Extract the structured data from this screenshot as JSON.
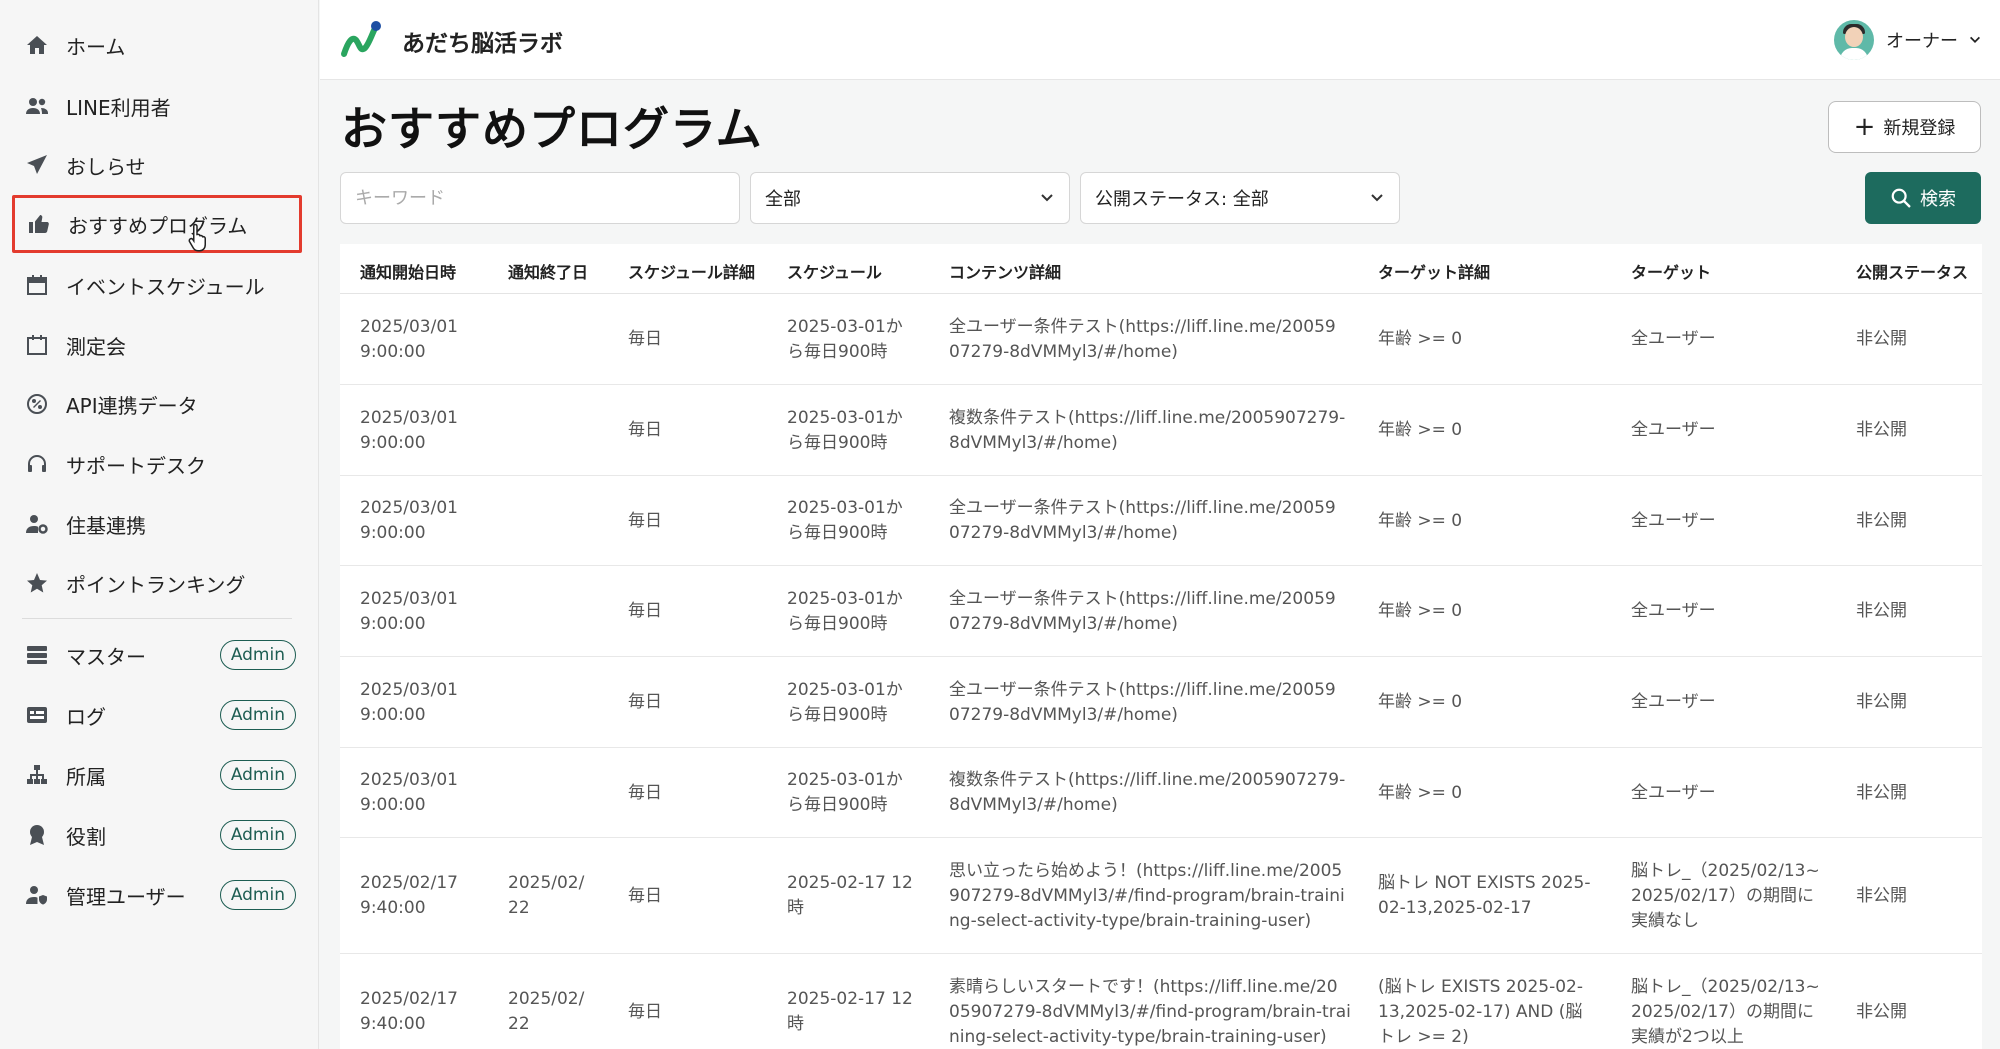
{
  "header": {
    "app_title": "あだち脳活ラボ",
    "user_name": "オーナー"
  },
  "sidebar": {
    "items": [
      {
        "label": "ホーム",
        "icon": "home-icon"
      },
      {
        "label": "LINE利用者",
        "icon": "users-icon"
      },
      {
        "label": "おしらせ",
        "icon": "send-icon"
      },
      {
        "label": "おすすめプログラム",
        "icon": "thumbs-up-icon"
      },
      {
        "label": "イベントスケジュール",
        "icon": "calendar-icon"
      },
      {
        "label": "測定会",
        "icon": "calendar-blank-icon"
      },
      {
        "label": "API連携データ",
        "icon": "link-icon"
      },
      {
        "label": "サポートデスク",
        "icon": "headset-icon"
      },
      {
        "label": "住基連携",
        "icon": "user-gear-icon"
      },
      {
        "label": "ポイントランキング",
        "icon": "star-icon"
      }
    ],
    "admin_items": [
      {
        "label": "マスター",
        "badge": "Admin",
        "icon": "database-icon"
      },
      {
        "label": "ログ",
        "badge": "Admin",
        "icon": "log-icon"
      },
      {
        "label": "所属",
        "badge": "Admin",
        "icon": "org-icon"
      },
      {
        "label": "役割",
        "badge": "Admin",
        "icon": "award-icon"
      },
      {
        "label": "管理ユーザー",
        "badge": "Admin",
        "icon": "user-shield-icon"
      }
    ]
  },
  "main": {
    "title": "おすすめプログラム",
    "new_button": "新規登録",
    "search": {
      "keyword_placeholder": "キーワード",
      "category_value": "全部",
      "status_value": "公開ステータス: 全部",
      "button": "検索"
    },
    "table": {
      "columns": [
        "通知開始日時",
        "通知終了日",
        "スケジュール詳細",
        "スケジュール",
        "コンテンツ詳細",
        "ターゲット詳細",
        "ターゲット",
        "公開ステータス"
      ],
      "rows": [
        {
          "start_1": "2025/03/01",
          "start_2": "9:00:00",
          "end_1": "",
          "end_2": "",
          "detail": "毎日",
          "sched_1": "2025-03-01か",
          "sched_2": "ら毎日900時",
          "content_1": "全ユーザー条件テスト(https://liff.line.me/20059",
          "content_2": "07279-8dVMMyl3/#/home)",
          "content_3": "",
          "tdetail_1": "年齢 >= 0",
          "tdetail_2": "",
          "tdetail_3": "",
          "target_1": "全ユーザー",
          "target_2": "",
          "target_3": "",
          "status": "非公開"
        },
        {
          "start_1": "2025/03/01",
          "start_2": "9:00:00",
          "end_1": "",
          "end_2": "",
          "detail": "毎日",
          "sched_1": "2025-03-01か",
          "sched_2": "ら毎日900時",
          "content_1": "複数条件テスト(https://liff.line.me/2005907279-",
          "content_2": "8dVMMyl3/#/home)",
          "content_3": "",
          "tdetail_1": "年齢 >= 0",
          "tdetail_2": "",
          "tdetail_3": "",
          "target_1": "全ユーザー",
          "target_2": "",
          "target_3": "",
          "status": "非公開"
        },
        {
          "start_1": "2025/03/01",
          "start_2": "9:00:00",
          "end_1": "",
          "end_2": "",
          "detail": "毎日",
          "sched_1": "2025-03-01か",
          "sched_2": "ら毎日900時",
          "content_1": "全ユーザー条件テスト(https://liff.line.me/20059",
          "content_2": "07279-8dVMMyl3/#/home)",
          "content_3": "",
          "tdetail_1": "年齢 >= 0",
          "tdetail_2": "",
          "tdetail_3": "",
          "target_1": "全ユーザー",
          "target_2": "",
          "target_3": "",
          "status": "非公開"
        },
        {
          "start_1": "2025/03/01",
          "start_2": "9:00:00",
          "end_1": "",
          "end_2": "",
          "detail": "毎日",
          "sched_1": "2025-03-01か",
          "sched_2": "ら毎日900時",
          "content_1": "全ユーザー条件テスト(https://liff.line.me/20059",
          "content_2": "07279-8dVMMyl3/#/home)",
          "content_3": "",
          "tdetail_1": "年齢 >= 0",
          "tdetail_2": "",
          "tdetail_3": "",
          "target_1": "全ユーザー",
          "target_2": "",
          "target_3": "",
          "status": "非公開"
        },
        {
          "start_1": "2025/03/01",
          "start_2": "9:00:00",
          "end_1": "",
          "end_2": "",
          "detail": "毎日",
          "sched_1": "2025-03-01か",
          "sched_2": "ら毎日900時",
          "content_1": "全ユーザー条件テスト(https://liff.line.me/20059",
          "content_2": "07279-8dVMMyl3/#/home)",
          "content_3": "",
          "tdetail_1": "年齢 >= 0",
          "tdetail_2": "",
          "tdetail_3": "",
          "target_1": "全ユーザー",
          "target_2": "",
          "target_3": "",
          "status": "非公開"
        },
        {
          "start_1": "2025/03/01",
          "start_2": "9:00:00",
          "end_1": "",
          "end_2": "",
          "detail": "毎日",
          "sched_1": "2025-03-01か",
          "sched_2": "ら毎日900時",
          "content_1": "複数条件テスト(https://liff.line.me/2005907279-",
          "content_2": "8dVMMyl3/#/home)",
          "content_3": "",
          "tdetail_1": "年齢 >= 0",
          "tdetail_2": "",
          "tdetail_3": "",
          "target_1": "全ユーザー",
          "target_2": "",
          "target_3": "",
          "status": "非公開"
        },
        {
          "start_1": "2025/02/17",
          "start_2": "9:40:00",
          "end_1": "2025/02/",
          "end_2": "22",
          "detail": "毎日",
          "sched_1": "2025-02-17 12",
          "sched_2": "時",
          "content_1": "思い立ったら始めよう！(https://liff.line.me/2005",
          "content_2": "907279-8dVMMyl3/#/find-program/brain-traini",
          "content_3": "ng-select-activity-type/brain-training-user)",
          "tdetail_1": "脳トレ NOT EXISTS 2025-",
          "tdetail_2": "02-13,2025-02-17",
          "tdetail_3": "",
          "target_1": "脳トレ_（2025/02/13~",
          "target_2": "2025/02/17）の期間に",
          "target_3": "実績なし",
          "status": "非公開"
        },
        {
          "start_1": "2025/02/17",
          "start_2": "9:40:00",
          "end_1": "2025/02/",
          "end_2": "22",
          "detail": "毎日",
          "sched_1": "2025-02-17 12",
          "sched_2": "時",
          "content_1": "素晴らしいスタートです！(https://liff.line.me/20",
          "content_2": "05907279-8dVMMyl3/#/find-program/brain-trai",
          "content_3": "ning-select-activity-type/brain-training-user)",
          "tdetail_1": "(脳トレ EXISTS 2025-02-",
          "tdetail_2": "13,2025-02-17) AND (脳",
          "tdetail_3": "トレ >= 2)",
          "target_1": "脳トレ_（2025/02/13~",
          "target_2": "2025/02/17）の期間に",
          "target_3": "実績が2つ以上",
          "status": "非公開"
        }
      ]
    }
  }
}
